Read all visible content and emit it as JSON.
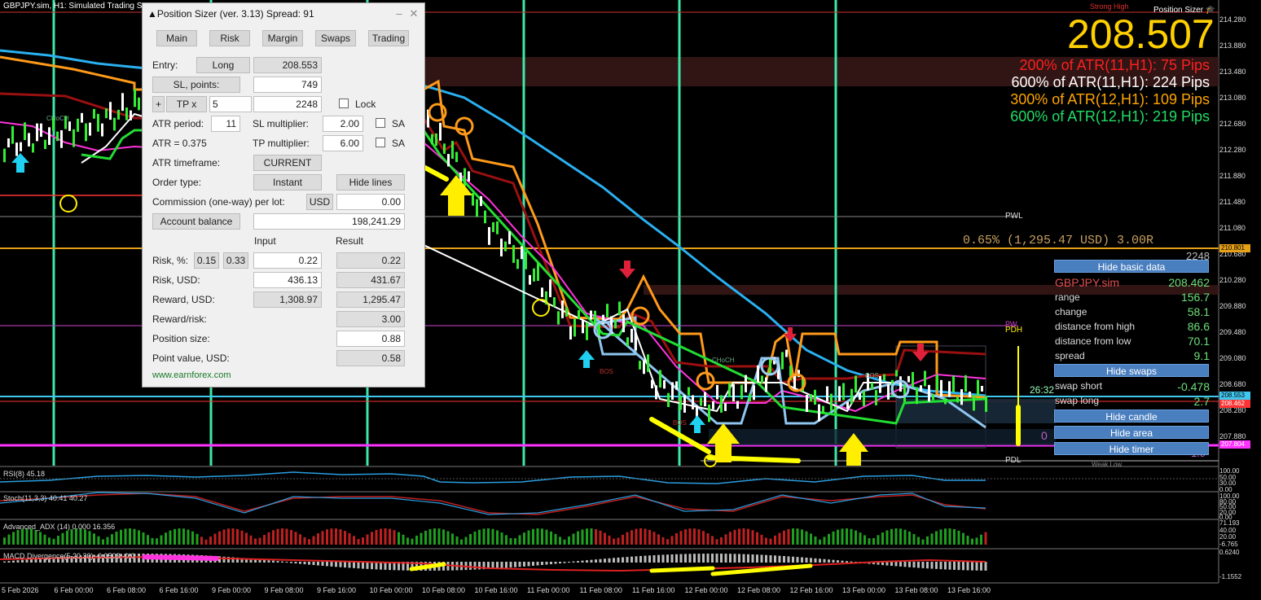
{
  "chart": {
    "title": "GBPJPY.sim, H1:  Simulated Trading Sp",
    "strong_high": "Strong High",
    "weak_low": "Weak Low",
    "pwl": "PWL",
    "pdl": "PDL",
    "pdh": "PDH",
    "pwh": "PW",
    "choch_1": "CHoCH",
    "choch_2": "CHoCH",
    "bos_1": "BOS",
    "bos_2": "BOS",
    "bos_3": "BOS",
    "timer": "26:32",
    "lines_text": "0.65% (1,295.47 USD) 3.00R",
    "tp_points": "2248",
    "sl_text": "0",
    "sl_text2": "1.9"
  },
  "price_axis": {
    "ticks": [
      "214.280",
      "213.880",
      "213.480",
      "213.080",
      "212.680",
      "212.280",
      "211.880",
      "211.480",
      "211.080",
      "210.680",
      "210.280",
      "209.880",
      "209.480",
      "209.080",
      "208.680",
      "208.280",
      "207.880"
    ],
    "tag_tp": "210.801",
    "tag_bid": "208.553",
    "tag_entry": "208.462",
    "tag_sl": "207.804"
  },
  "time_axis": [
    "5 Feb 2026",
    "6 Feb 00:00",
    "6 Feb 08:00",
    "6 Feb 16:00",
    "9 Feb 00:00",
    "9 Feb 08:00",
    "9 Feb 16:00",
    "10 Feb 00:00",
    "10 Feb 08:00",
    "10 Feb 16:00",
    "11 Feb 00:00",
    "11 Feb 08:00",
    "11 Feb 16:00",
    "12 Feb 00:00",
    "12 Feb 08:00",
    "12 Feb 16:00",
    "13 Feb 00:00",
    "13 Feb 08:00",
    "13 Feb 16:00"
  ],
  "indicators": {
    "rsi_label": "RSI(8) 45.18",
    "rsi_ticks": [
      "100.00",
      "50.00",
      "30.00",
      "0.00"
    ],
    "stoch_label": "Stoch(11,3,3) 40.41 40.27",
    "stoch_ticks": [
      "100.00",
      "80.00",
      "50.00",
      "20.00",
      "0.00"
    ],
    "adx_label": "Advanced_ADX (14) 0.000 16.356",
    "adx_ticks": [
      "71.193",
      "40.00",
      "20.00",
      "-6.765"
    ],
    "macd_label": "MACD Divergence(5,20,30) -0.0503 -0.0",
    "macd_ticks": [
      "0.6240",
      "-1.1552"
    ]
  },
  "position_sizer": {
    "title": "▲Position Sizer (ver. 3.13) Spread: 91",
    "tabs": [
      "Main",
      "Risk",
      "Margin",
      "Swaps",
      "Trading"
    ],
    "entry_label": "Entry:",
    "entry_type": "Long",
    "entry_value": "208.553",
    "sl_button": "SL, points:",
    "sl_value": "749",
    "tp_plus": "+",
    "tp_button": "TP x",
    "tp_mult": "5",
    "tp_value": "2248",
    "lock_label": "Lock",
    "atr_period_label": "ATR period:",
    "atr_period_value": "11",
    "sl_mult_label": "SL multiplier:",
    "sl_mult_value": "2.00",
    "sa_label_1": "SA",
    "atr_value_label": "ATR = 0.375",
    "tp_mult_label": "TP multiplier:",
    "tp_mult_value": "6.00",
    "sa_label_2": "SA",
    "atr_tf_label": "ATR timeframe:",
    "atr_tf_value": "CURRENT",
    "order_type_label": "Order type:",
    "order_type_value": "Instant",
    "hide_lines": "Hide lines",
    "commission_label": "Commission (one-way) per lot:",
    "commission_currency": "USD",
    "commission_value": "0.00",
    "account_balance_btn": "Account balance",
    "account_balance_value": "198,241.29",
    "col_input": "Input",
    "col_result": "Result",
    "risk_pct_label": "Risk, %:",
    "risk_preset_1": "0.15",
    "risk_preset_2": "0.33",
    "risk_pct_input": "0.22",
    "risk_pct_result": "0.22",
    "risk_usd_label": "Risk, USD:",
    "risk_usd_input": "436.13",
    "risk_usd_result": "431.67",
    "reward_usd_label": "Reward, USD:",
    "reward_usd_input": "1,308.97",
    "reward_usd_result": "1,295.47",
    "rr_label": "Reward/risk:",
    "rr_result": "3.00",
    "pos_size_label": "Position size:",
    "pos_size_value": "0.88",
    "point_value_label": "Point value, USD:",
    "point_value_value": "0.58",
    "website": "www.earnforex.com"
  },
  "right_info": {
    "ps_label": "Position Sizer",
    "big_price": "208.507",
    "atr_lines": [
      {
        "text": "200% of ATR(11,H1): 75  Pips",
        "color": "#ff2020"
      },
      {
        "text": "600% of ATR(11,H1): 224  Pips",
        "color": "#ffffff"
      },
      {
        "text": "300% of ATR(12,H1): 109  Pips",
        "color": "#ffa500"
      },
      {
        "text": "600% of ATR(12,H1): 219  Pips",
        "color": "#22dd66"
      }
    ],
    "hide_basic_data": "Hide basic data",
    "symbol": "GBPJPY.sim",
    "symbol_price": "208.462",
    "rows": [
      {
        "label": "range",
        "value": "156.7"
      },
      {
        "label": "change",
        "value": "58.1"
      },
      {
        "label": "distance from high",
        "value": "86.6"
      },
      {
        "label": "distance from low",
        "value": "70.1"
      },
      {
        "label": "spread",
        "value": "9.1"
      }
    ],
    "hide_swaps": "Hide swaps",
    "swap_short_label": "swap short",
    "swap_short_value": "-0.478",
    "swap_long_label": "swap long",
    "swap_long_value": "2.7",
    "hide_candle": "Hide candle",
    "hide_area": "Hide area",
    "hide_timer": "Hide timer"
  }
}
